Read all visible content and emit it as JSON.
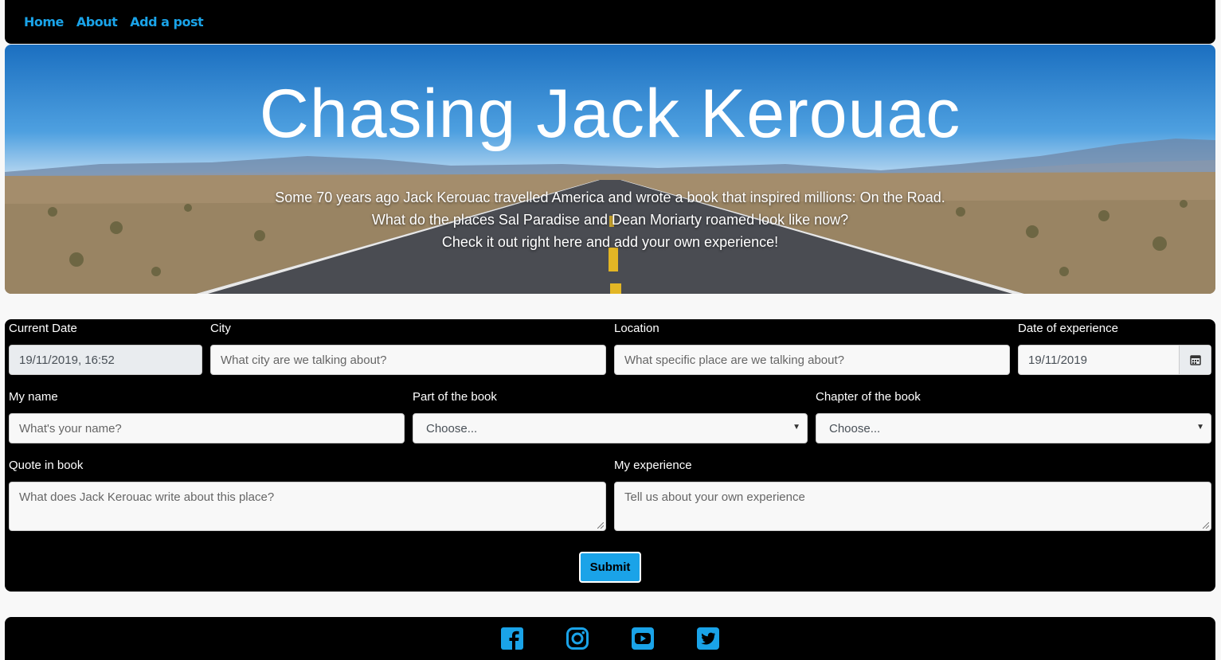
{
  "nav": {
    "items": [
      "Home",
      "About",
      "Add a post"
    ]
  },
  "hero": {
    "title": "Chasing Jack Kerouac",
    "lines": [
      "Some 70 years ago Jack Kerouac travelled America and wrote a book that inspired millions: On the Road.",
      "What do the places Sal Paradise and Dean Moriarty roamed look like now?",
      "Check it out right here and add your own experience!"
    ]
  },
  "form": {
    "current_date": {
      "label": "Current Date",
      "value": "19/11/2019, 16:52"
    },
    "city": {
      "label": "City",
      "placeholder": "What city are we talking about?"
    },
    "location": {
      "label": "Location",
      "placeholder": "What specific place are we talking about?"
    },
    "date_of_experience": {
      "label": "Date of experience",
      "value": "19/11/2019"
    },
    "my_name": {
      "label": "My name",
      "placeholder": "What's your name?"
    },
    "part_of_book": {
      "label": "Part of the book",
      "selected": "Choose..."
    },
    "chapter_of_book": {
      "label": "Chapter of the book",
      "selected": "Choose..."
    },
    "quote": {
      "label": "Quote in book",
      "placeholder": "What does Jack Kerouac write about this place?"
    },
    "experience": {
      "label": "My experience",
      "placeholder": "Tell us about your own experience"
    },
    "submit_label": "Submit"
  },
  "footer": {
    "icons": [
      "facebook-icon",
      "instagram-icon",
      "youtube-icon",
      "twitter-icon"
    ]
  },
  "colors": {
    "accent": "#1aa3e8",
    "panel": "#000000",
    "page_bg": "#f8f8f8"
  }
}
